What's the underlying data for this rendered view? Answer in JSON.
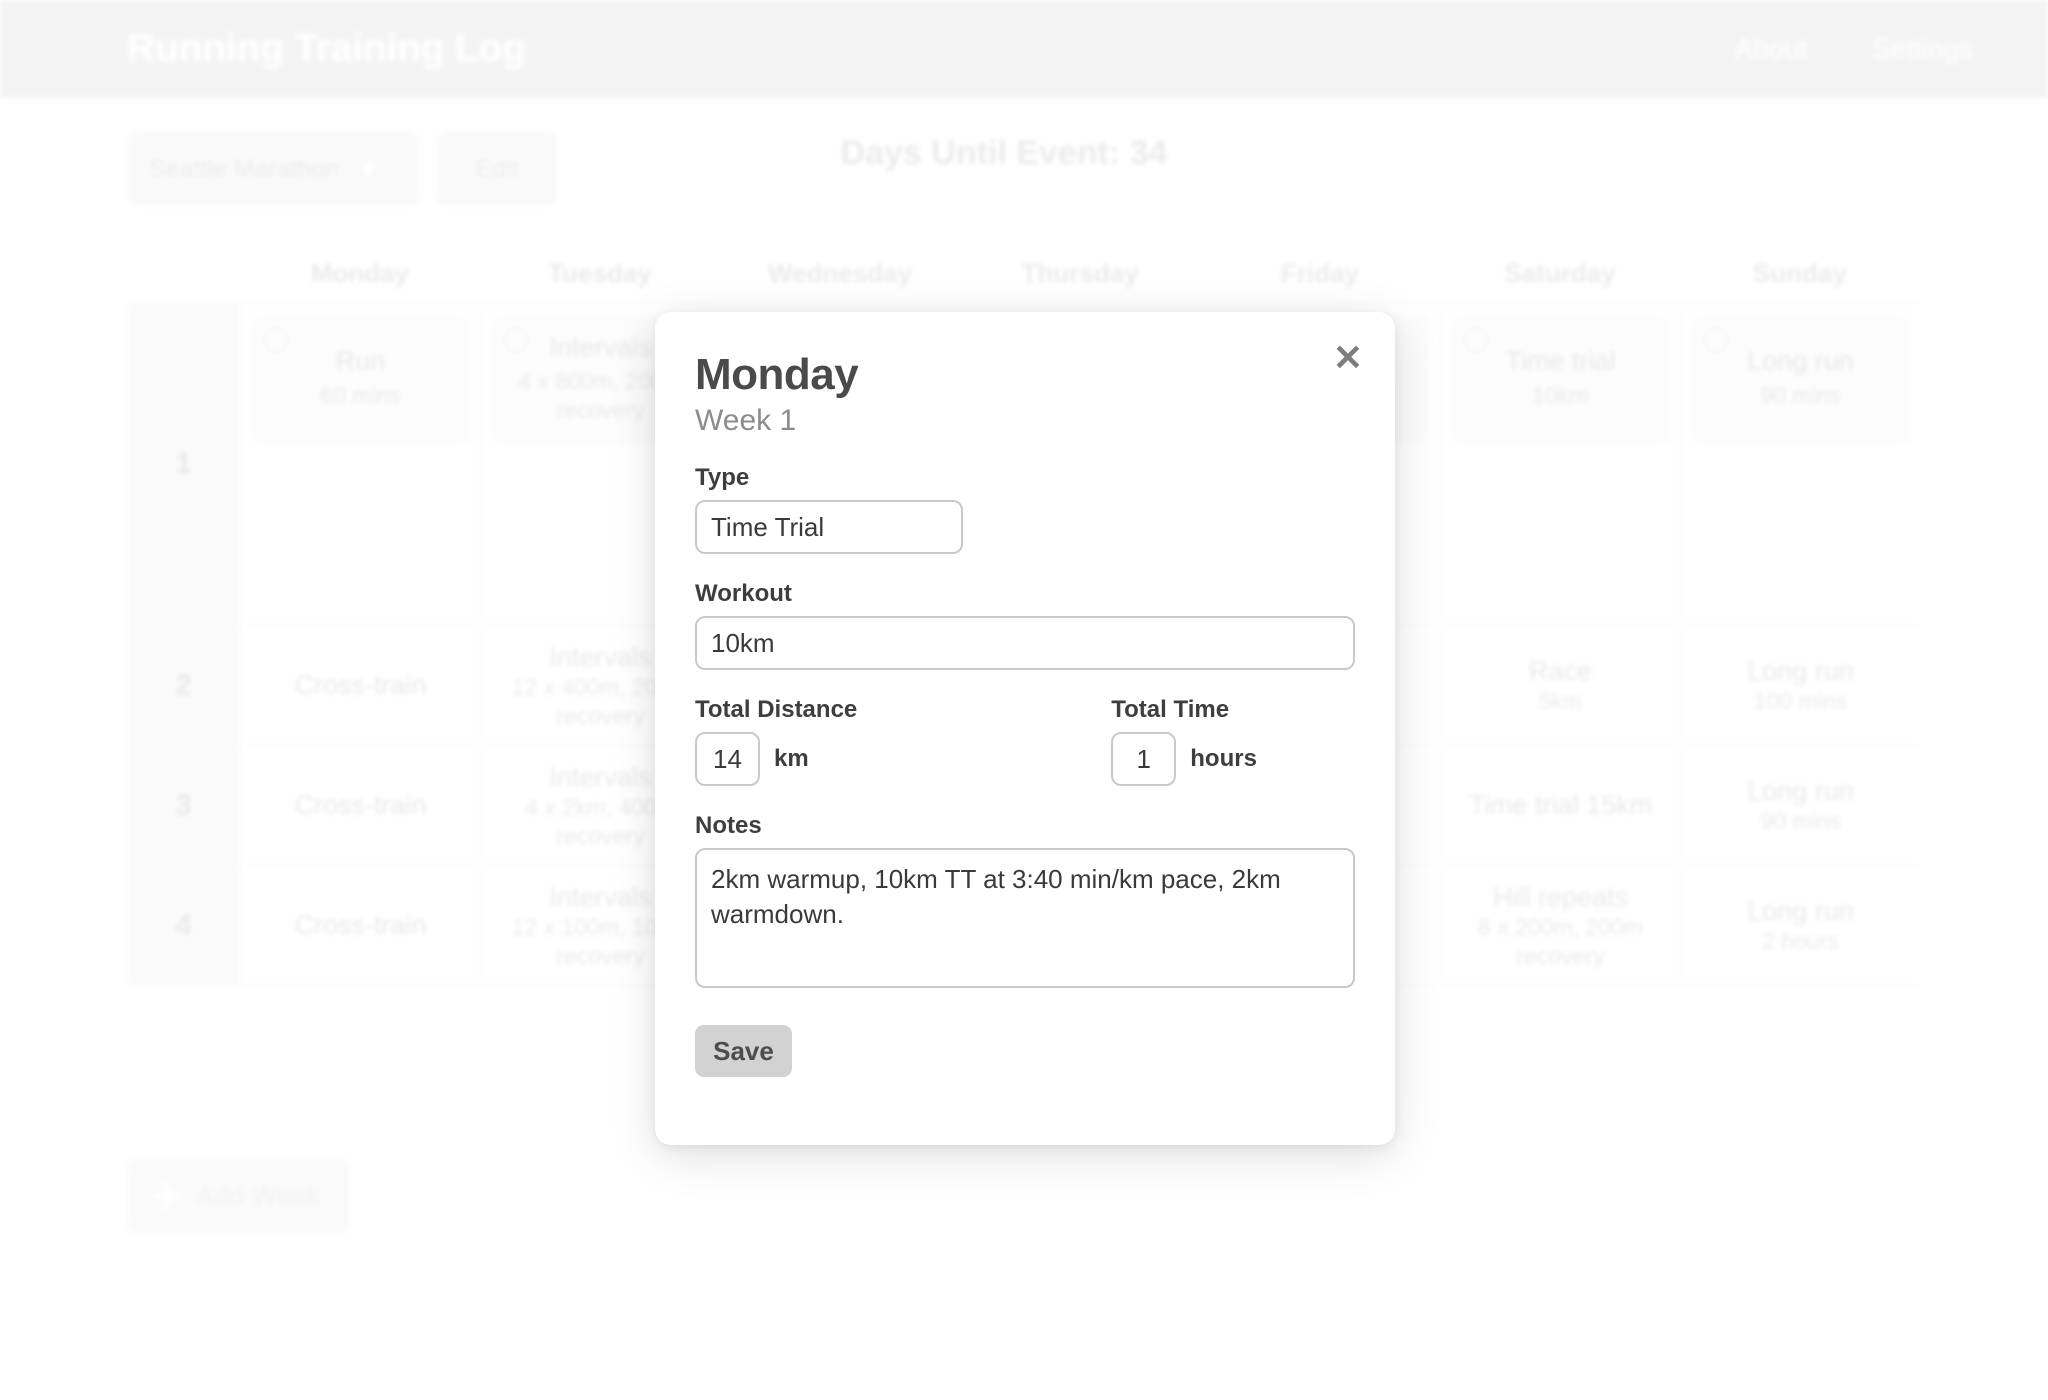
{
  "app": {
    "title": "Running Training Log",
    "nav": [
      {
        "label": "About",
        "name": "about"
      },
      {
        "label": "Settings",
        "name": "settings"
      }
    ]
  },
  "toolbar": {
    "plan_name": "Seattle Marathon",
    "plan_chevron": "chevron-down-icon",
    "edit_label": "Edit",
    "countdown": "Days Until Event: 34"
  },
  "calendar": {
    "week_col_header": "",
    "days": [
      "Monday",
      "Tuesday",
      "Wednesday",
      "Thursday",
      "Friday",
      "Saturday",
      "Sunday"
    ],
    "weeks": [
      {
        "number": "1",
        "cells": [
          {
            "title": "Run",
            "sub": "60 mins",
            "card": true,
            "checkbox": true
          },
          {
            "title": "Intervals",
            "sub": "4 x 800m, 200m recovery",
            "card": true,
            "checkbox": true
          },
          {
            "title": "",
            "sub": "",
            "card": true,
            "checkbox": true
          },
          {
            "title": "",
            "sub": "",
            "card": true,
            "checkbox": true
          },
          {
            "title": "",
            "sub": "",
            "card": true,
            "checkbox": true
          },
          {
            "title": "Time trial",
            "sub": "10km",
            "card": true,
            "checkbox": true
          },
          {
            "title": "Long run",
            "sub": "90 mins",
            "card": true,
            "checkbox": true
          }
        ]
      },
      {
        "number": "2",
        "cells": [
          {
            "title": "Cross-train",
            "sub": "",
            "card": false,
            "checkbox": false
          },
          {
            "title": "Intervals",
            "sub": "12 x 400m, 200m recovery",
            "card": false,
            "checkbox": false
          },
          {
            "title": "",
            "sub": "",
            "card": false,
            "checkbox": false
          },
          {
            "title": "",
            "sub": "",
            "card": false,
            "checkbox": false
          },
          {
            "title": "",
            "sub": "",
            "card": false,
            "checkbox": false
          },
          {
            "title": "Race",
            "sub": "5km",
            "card": false,
            "checkbox": false
          },
          {
            "title": "Long run",
            "sub": "100 mins",
            "card": false,
            "checkbox": false
          }
        ]
      },
      {
        "number": "3",
        "cells": [
          {
            "title": "Cross-train",
            "sub": "",
            "card": false,
            "checkbox": false
          },
          {
            "title": "Intervals",
            "sub": "4 x 2km, 400m recovery",
            "card": false,
            "checkbox": false
          },
          {
            "title": "",
            "sub": "",
            "card": false,
            "checkbox": false
          },
          {
            "title": "",
            "sub": "",
            "card": false,
            "checkbox": false
          },
          {
            "title": "",
            "sub": "",
            "card": false,
            "checkbox": false
          },
          {
            "title": "Time trial 15km",
            "sub": "",
            "card": false,
            "checkbox": false
          },
          {
            "title": "Long run",
            "sub": "90 mins",
            "card": false,
            "checkbox": false
          }
        ]
      },
      {
        "number": "4",
        "cells": [
          {
            "title": "Cross-train",
            "sub": "",
            "card": false,
            "checkbox": false
          },
          {
            "title": "Intervals",
            "sub": "12 x 100m, 100m recovery",
            "card": false,
            "checkbox": false
          },
          {
            "title": "",
            "sub": "",
            "card": false,
            "checkbox": false
          },
          {
            "title": "",
            "sub": "",
            "card": false,
            "checkbox": false
          },
          {
            "title": "",
            "sub": "",
            "card": false,
            "checkbox": false
          },
          {
            "title": "Hill repeats",
            "sub": "8 x 200m, 200m recovery",
            "card": false,
            "checkbox": false
          },
          {
            "title": "Long run",
            "sub": "2 hours",
            "card": false,
            "checkbox": false
          }
        ]
      }
    ],
    "add_week_label": "Add Week",
    "add_week_icon": "plus-icon"
  },
  "modal": {
    "close_icon": "close-icon",
    "day": "Monday",
    "week": "Week 1",
    "type_label": "Type",
    "type_value": "Time Trial",
    "workout_label": "Workout",
    "workout_value": "10km",
    "distance_label": "Total Distance",
    "distance_value": "14",
    "distance_unit": "km",
    "time_label": "Total Time",
    "time_value": "1",
    "time_unit": "hours",
    "notes_label": "Notes",
    "notes_value": "2km warmup, 10km TT at 3:40 min/km pace, 2km warmdown.",
    "save_label": "Save"
  },
  "colors": {
    "header_bg": "#e9e9e9",
    "muted_text": "#d2d2d2",
    "modal_text": "#3e3e3e",
    "save_bg": "#d2d2d2"
  }
}
